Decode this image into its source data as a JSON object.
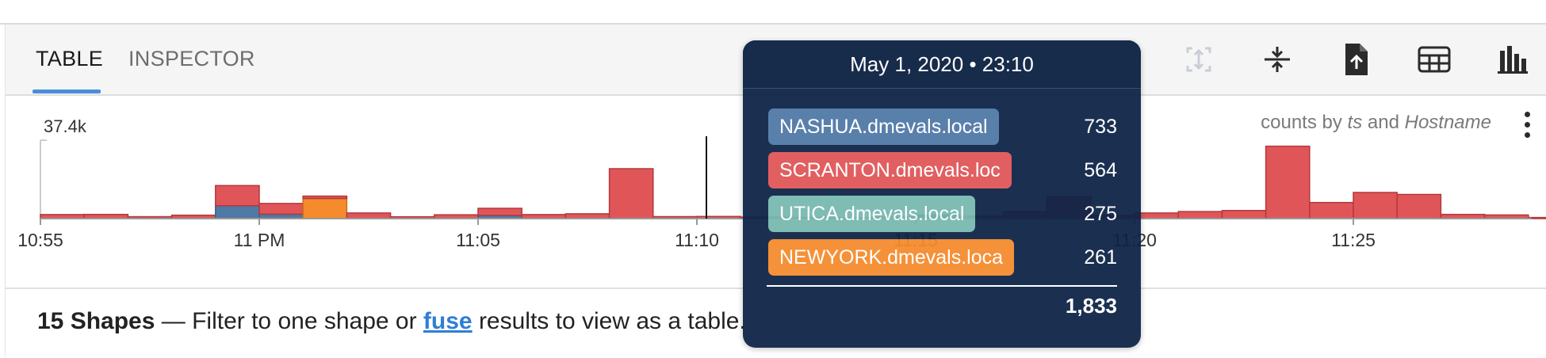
{
  "tabs": [
    {
      "label": "TABLE",
      "active": true
    },
    {
      "label": "INSPECTOR",
      "active": false
    }
  ],
  "toolbar": [
    {
      "icon": "expand-frame-icon",
      "enabled": false
    },
    {
      "icon": "collapse-vertical-icon",
      "enabled": true
    },
    {
      "icon": "export-file-icon",
      "enabled": true
    },
    {
      "icon": "table-view-icon",
      "enabled": true
    },
    {
      "icon": "bar-chart-icon",
      "enabled": true
    }
  ],
  "chart_caption": {
    "prefix": "counts by ",
    "field1": "ts",
    "middle": " and ",
    "field2": "Hostname"
  },
  "chart_data": {
    "type": "bar",
    "stacked": true,
    "y_max_label": "37.4k",
    "ylim": [
      0,
      37400
    ],
    "x_ticks": [
      "10:55",
      "11 PM",
      "11:05",
      "11:10",
      "11:15",
      "11:20",
      "11:25"
    ],
    "x_start": "22:55",
    "bin_minutes": 1,
    "colors": {
      "red": "#e05658",
      "blue": "#4f79a6",
      "orange": "#f58b2c",
      "teal": "#76b8b0",
      "navy": "#0f2a55"
    },
    "bins": [
      {
        "red": 2000
      },
      {
        "red": 2100
      },
      {
        "red": 950
      },
      {
        "red": 1700
      },
      {
        "blue": 6400,
        "red": 10000
      },
      {
        "blue": 2200,
        "red": 5300
      },
      {
        "orange": 10000,
        "red": 1200
      },
      {
        "red": 2800
      },
      {
        "red": 900
      },
      {
        "red": 1900
      },
      {
        "blue": 1600,
        "red": 3500
      },
      {
        "red": 2000
      },
      {
        "red": 2400
      },
      {
        "red": 24800
      },
      {
        "red": 1000
      },
      {
        "red": 1050
      },
      {
        "red": 700
      },
      {
        "red": 550
      },
      {
        "red": 450
      },
      {
        "red": 800
      },
      {
        "navy": 1833
      },
      {
        "red": 1200
      },
      {
        "red": 3500
      },
      {
        "red": 11000
      },
      {
        "red": 1600
      },
      {
        "red": 2800
      },
      {
        "red": 3500
      },
      {
        "red": 4000
      },
      {
        "red": 36000
      },
      {
        "red": 8000
      },
      {
        "red": 13000
      },
      {
        "red": 12000
      },
      {
        "red": 2100
      },
      {
        "red": 1800
      },
      {
        "red": 550
      },
      {
        "red": 450
      }
    ]
  },
  "tooltip": {
    "title": "May 1, 2020 • 23:10",
    "rows": [
      {
        "host": "NASHUA.dmevals.local",
        "value": "733",
        "color": "#4f79a6"
      },
      {
        "host": "SCRANTON.dmevals.loc",
        "value": "564",
        "color": "#e05658"
      },
      {
        "host": "UTICA.dmevals.local",
        "value": "275",
        "color": "#76b8b0"
      },
      {
        "host": "NEWYORK.dmevals.loca",
        "value": "261",
        "color": "#f58b2c"
      }
    ],
    "total": "1,833"
  },
  "footer": {
    "count": "15 Shapes",
    "text_before": " — Filter to one shape or ",
    "link": "fuse",
    "text_after": " results to view as a table."
  }
}
